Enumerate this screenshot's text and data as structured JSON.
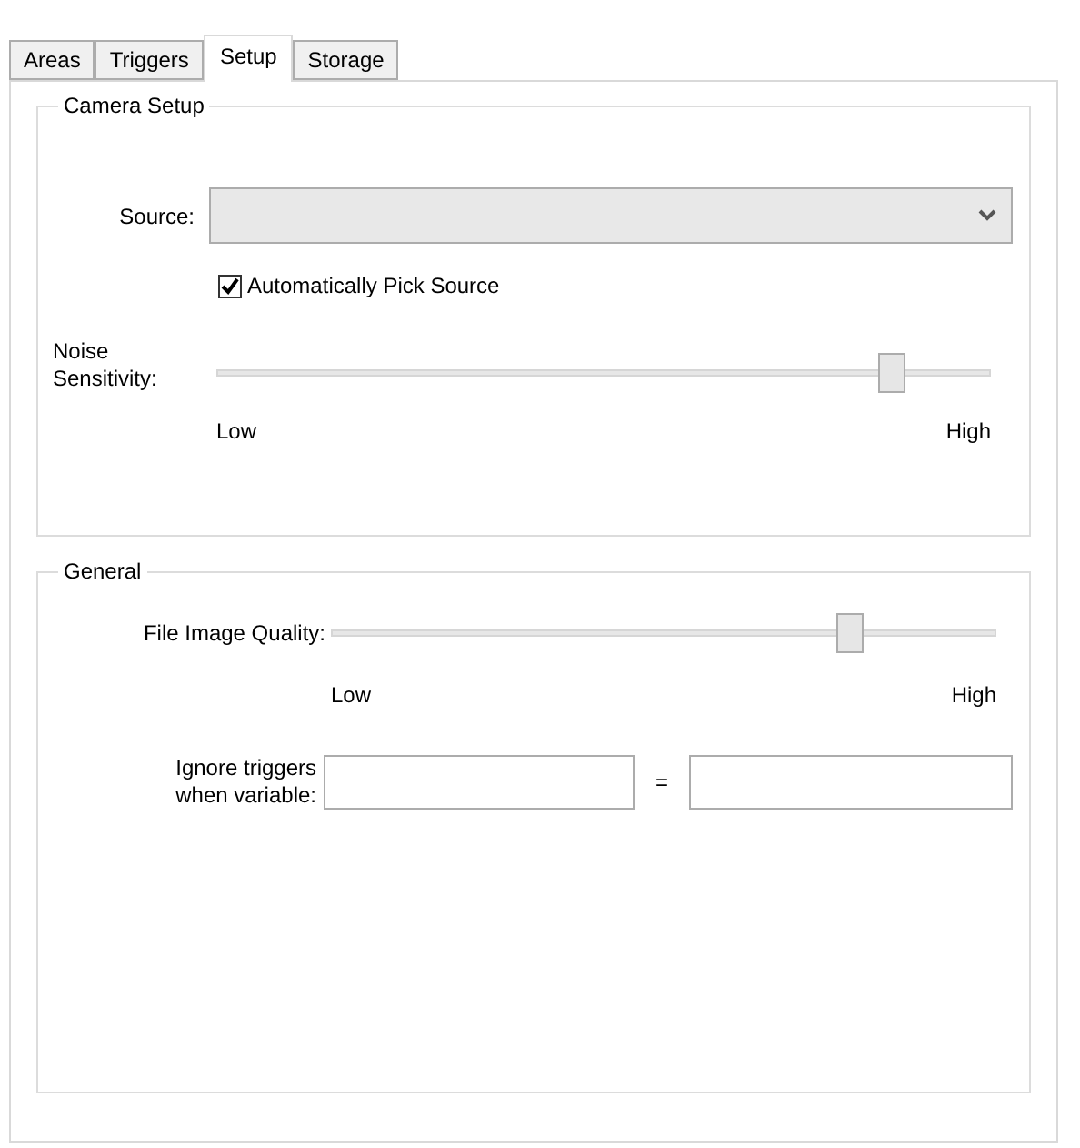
{
  "tabs": [
    {
      "label": "Areas",
      "selected": false
    },
    {
      "label": "Triggers",
      "selected": false
    },
    {
      "label": "Setup",
      "selected": true
    },
    {
      "label": "Storage",
      "selected": false
    }
  ],
  "camera_setup": {
    "title": "Camera Setup",
    "source": {
      "label": "Source:"
    },
    "auto_pick": {
      "label": "Automatically Pick Source",
      "checked": true
    },
    "noise_sensitivity": {
      "label_lines": [
        "Noise",
        "Sensitivity:"
      ],
      "level": 0.87,
      "min_label": "Low",
      "max_label": "High"
    }
  },
  "general": {
    "title": "General",
    "file_image_quality": {
      "label": "File Image Quality:",
      "level": 0.78,
      "min_label": "Low",
      "max_label": "High"
    },
    "ignore_triggers": {
      "label_lines": [
        "Ignore triggers",
        "when variable:"
      ],
      "separator": "="
    }
  }
}
